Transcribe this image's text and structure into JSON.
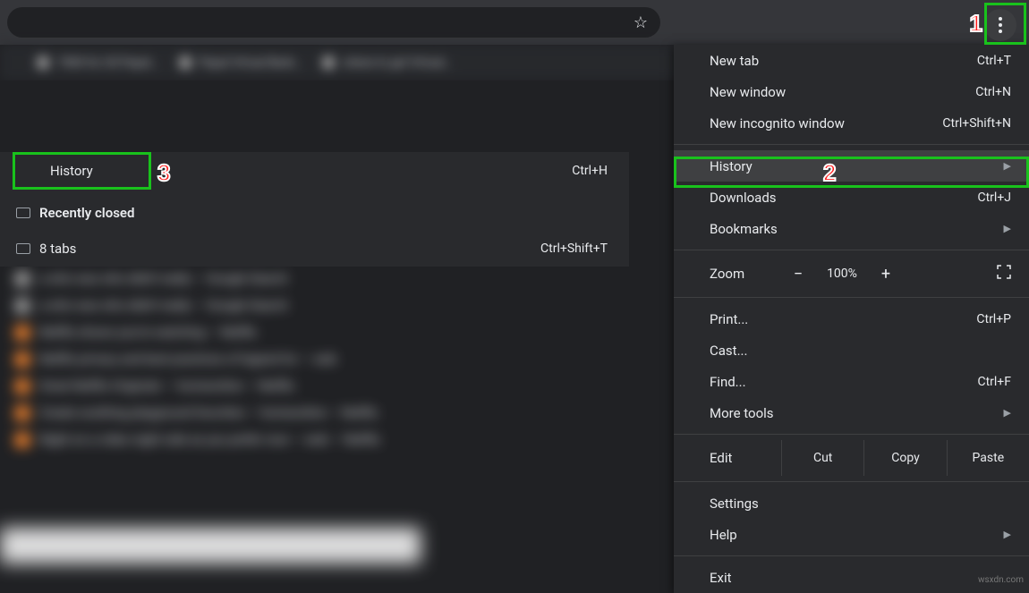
{
  "toolbar": {
    "star_glyph": "☆"
  },
  "bookmarks": [
    "1984 for US Papal…",
    "Papal Virtual Bank…",
    "where to get Virtual…"
  ],
  "submenu": {
    "history_label": "History",
    "history_shortcut": "Ctrl+H",
    "recently_closed_label": "Recently closed",
    "eight_tabs_label": "8 tabs",
    "eight_tabs_shortcut": "Ctrl+Shift+T"
  },
  "menu": {
    "new_tab": {
      "label": "New tab",
      "shortcut": "Ctrl+T"
    },
    "new_window": {
      "label": "New window",
      "shortcut": "Ctrl+N"
    },
    "new_incognito": {
      "label": "New incognito window",
      "shortcut": "Ctrl+Shift+N"
    },
    "history": {
      "label": "History"
    },
    "downloads": {
      "label": "Downloads",
      "shortcut": "Ctrl+J"
    },
    "bookmarks": {
      "label": "Bookmarks"
    },
    "zoom": {
      "label": "Zoom",
      "minus": "−",
      "pct": "100%",
      "plus": "+"
    },
    "print": {
      "label": "Print...",
      "shortcut": "Ctrl+P"
    },
    "cast": {
      "label": "Cast..."
    },
    "find": {
      "label": "Find...",
      "shortcut": "Ctrl+F"
    },
    "more_tools": {
      "label": "More tools"
    },
    "edit": {
      "label": "Edit",
      "cut": "Cut",
      "copy": "Copy",
      "paste": "Paste"
    },
    "settings": {
      "label": "Settings"
    },
    "help": {
      "label": "Help"
    },
    "exit": {
      "label": "Exit"
    }
  },
  "callouts": {
    "one": "1",
    "two": "2",
    "three": "3"
  },
  "watermark": "wsxdn.com",
  "colors": {
    "highlight": "#19c21c",
    "callout": "#ff1a1a"
  }
}
